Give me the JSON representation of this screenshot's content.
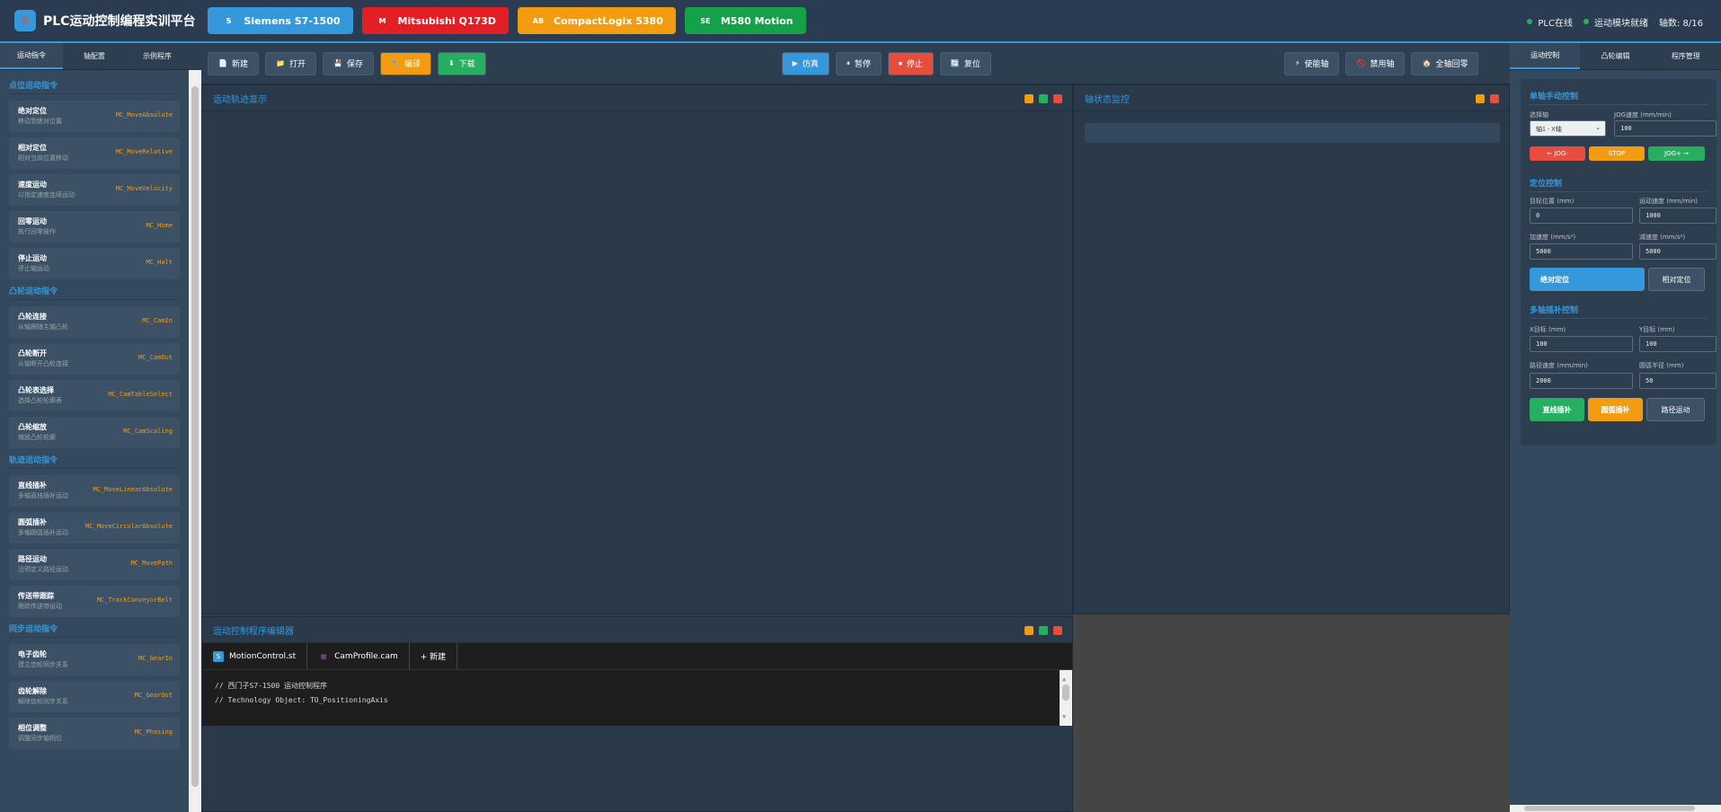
{
  "header": {
    "title": "PLC运动控制编程实训平台",
    "brands": [
      {
        "icon": "S",
        "label": "Siemens S7-1500",
        "color": "#3498db"
      },
      {
        "icon": "M",
        "label": "Mitsubishi Q173D",
        "color": "#e31e24"
      },
      {
        "icon": "AB",
        "label": "CompactLogix 5380",
        "color": "#f39c12"
      },
      {
        "icon": "SE",
        "label": "M580 Motion",
        "color": "#15a04a"
      }
    ],
    "status": {
      "plc": "PLC在线",
      "module": "运动模块就绪",
      "axes": "轴数: 8/16"
    }
  },
  "left_tabs": [
    "运动指令",
    "轴配置",
    "示例程序"
  ],
  "sections": [
    {
      "title": "点位运动指令",
      "items": [
        {
          "name": "绝对定位",
          "desc": "移动到绝对位置",
          "code": "MC_MoveAbsolute"
        },
        {
          "name": "相对定位",
          "desc": "相对当前位置移动",
          "code": "MC_MoveRelative"
        },
        {
          "name": "速度运动",
          "desc": "以指定速度连续运动",
          "code": "MC_MoveVelocity"
        },
        {
          "name": "回零运动",
          "desc": "执行回零操作",
          "code": "MC_Home"
        },
        {
          "name": "停止运动",
          "desc": "停止轴运动",
          "code": "MC_Halt"
        }
      ]
    },
    {
      "title": "凸轮运动指令",
      "items": [
        {
          "name": "凸轮连接",
          "desc": "从轴跟随主轴凸轮",
          "code": "MC_CamIn"
        },
        {
          "name": "凸轮断开",
          "desc": "从轴断开凸轮连接",
          "code": "MC_CamOut"
        },
        {
          "name": "凸轮表选择",
          "desc": "选择凸轮轮廓表",
          "code": "MC_CamTableSelect"
        },
        {
          "name": "凸轮缩放",
          "desc": "缩放凸轮轮廓",
          "code": "MC_CamScaling"
        }
      ]
    },
    {
      "title": "轨迹运动指令",
      "items": [
        {
          "name": "直线插补",
          "desc": "多轴直线插补运动",
          "code": "MC_MoveLinearAbsolute"
        },
        {
          "name": "圆弧插补",
          "desc": "多轴圆弧插补运动",
          "code": "MC_MoveCircularAbsolute"
        },
        {
          "name": "路径运动",
          "desc": "沿预定义路径运动",
          "code": "MC_MovePath"
        },
        {
          "name": "传送带跟踪",
          "desc": "跟踪传送带运动",
          "code": "MC_TrackConveyorBelt"
        }
      ]
    },
    {
      "title": "同步运动指令",
      "items": [
        {
          "name": "电子齿轮",
          "desc": "建立齿轮同步关系",
          "code": "MC_GearIn"
        },
        {
          "name": "齿轮解除",
          "desc": "解除齿轮同步关系",
          "code": "MC_GearOut"
        },
        {
          "name": "相位调整",
          "desc": "调整同步轴相位",
          "code": "MC_Phasing"
        }
      ]
    }
  ],
  "toolbar": {
    "file": [
      {
        "icon": "📄",
        "label": "新建",
        "color": "#3d5166"
      },
      {
        "icon": "📁",
        "label": "打开",
        "color": "#3d5166"
      },
      {
        "icon": "💾",
        "label": "保存",
        "color": "#3d5166"
      },
      {
        "icon": "🔧",
        "label": "编译",
        "color": "#f39c12"
      },
      {
        "icon": "⬇",
        "label": "下载",
        "color": "#27ae60"
      }
    ],
    "sim": [
      {
        "icon": "▶",
        "label": "仿真",
        "color": "#3498db"
      },
      {
        "icon": "⏸",
        "label": "暂停",
        "color": "#3d5166"
      },
      {
        "icon": "⏹",
        "label": "停止",
        "color": "#e74c3c"
      },
      {
        "icon": "🔄",
        "label": "复位",
        "color": "#3d5166"
      }
    ],
    "axis": [
      {
        "icon": "⚡",
        "label": "使能轴",
        "color": "#3d5166"
      },
      {
        "icon": "🚫",
        "label": "禁用轴",
        "color": "#3d5166"
      },
      {
        "icon": "🏠",
        "label": "全轴回零",
        "color": "#3d5166"
      }
    ]
  },
  "panels": {
    "trajectory": "运动轨迹显示",
    "axis_monitor": "轴状态监控",
    "editor": "运动控制程序编辑器"
  },
  "editor": {
    "tabs": [
      {
        "icon": "S",
        "label": "MotionControl.st"
      },
      {
        "icon": "▦",
        "label": "CamProfile.cam"
      },
      {
        "icon": "",
        "label": "+ 新建"
      }
    ],
    "lines": [
      "// 西门子S7-1500 运动控制程序",
      "// Technology Object: TO_PositioningAxis"
    ]
  },
  "right_tabs": [
    "运动控制",
    "凸轮编辑",
    "程序管理"
  ],
  "single_axis": {
    "title": "单轴手动控制",
    "axis_label": "选择轴",
    "axis_value": "轴1 - X轴",
    "jog_label": "JOG速度 (mm/min)",
    "jog_value": "100",
    "jog_minus": "← JOG-",
    "stop": "STOP",
    "jog_plus": "JOG+ →"
  },
  "positioning": {
    "title": "定位控制",
    "target_label": "目标位置 (mm)",
    "target_value": "0",
    "speed_label": "运动速度 (mm/min)",
    "speed_value": "1000",
    "acc_label": "加速度 (mm/s²)",
    "acc_value": "5000",
    "dec_label": "减速度 (mm/s²)",
    "dec_value": "5000",
    "abs_btn": "绝对定位",
    "rel_btn": "相对定位"
  },
  "interpolation": {
    "title": "多轴插补控制",
    "x_label": "X目标 (mm)",
    "x_value": "100",
    "y_label": "Y目标 (mm)",
    "y_value": "100",
    "path_label": "路径速度 (mm/min)",
    "path_value": "2000",
    "radius_label": "圆弧半径 (mm)",
    "radius_value": "50",
    "linear_btn": "直线插补",
    "circular_btn": "圆弧插补",
    "path_btn": "路径运动"
  }
}
